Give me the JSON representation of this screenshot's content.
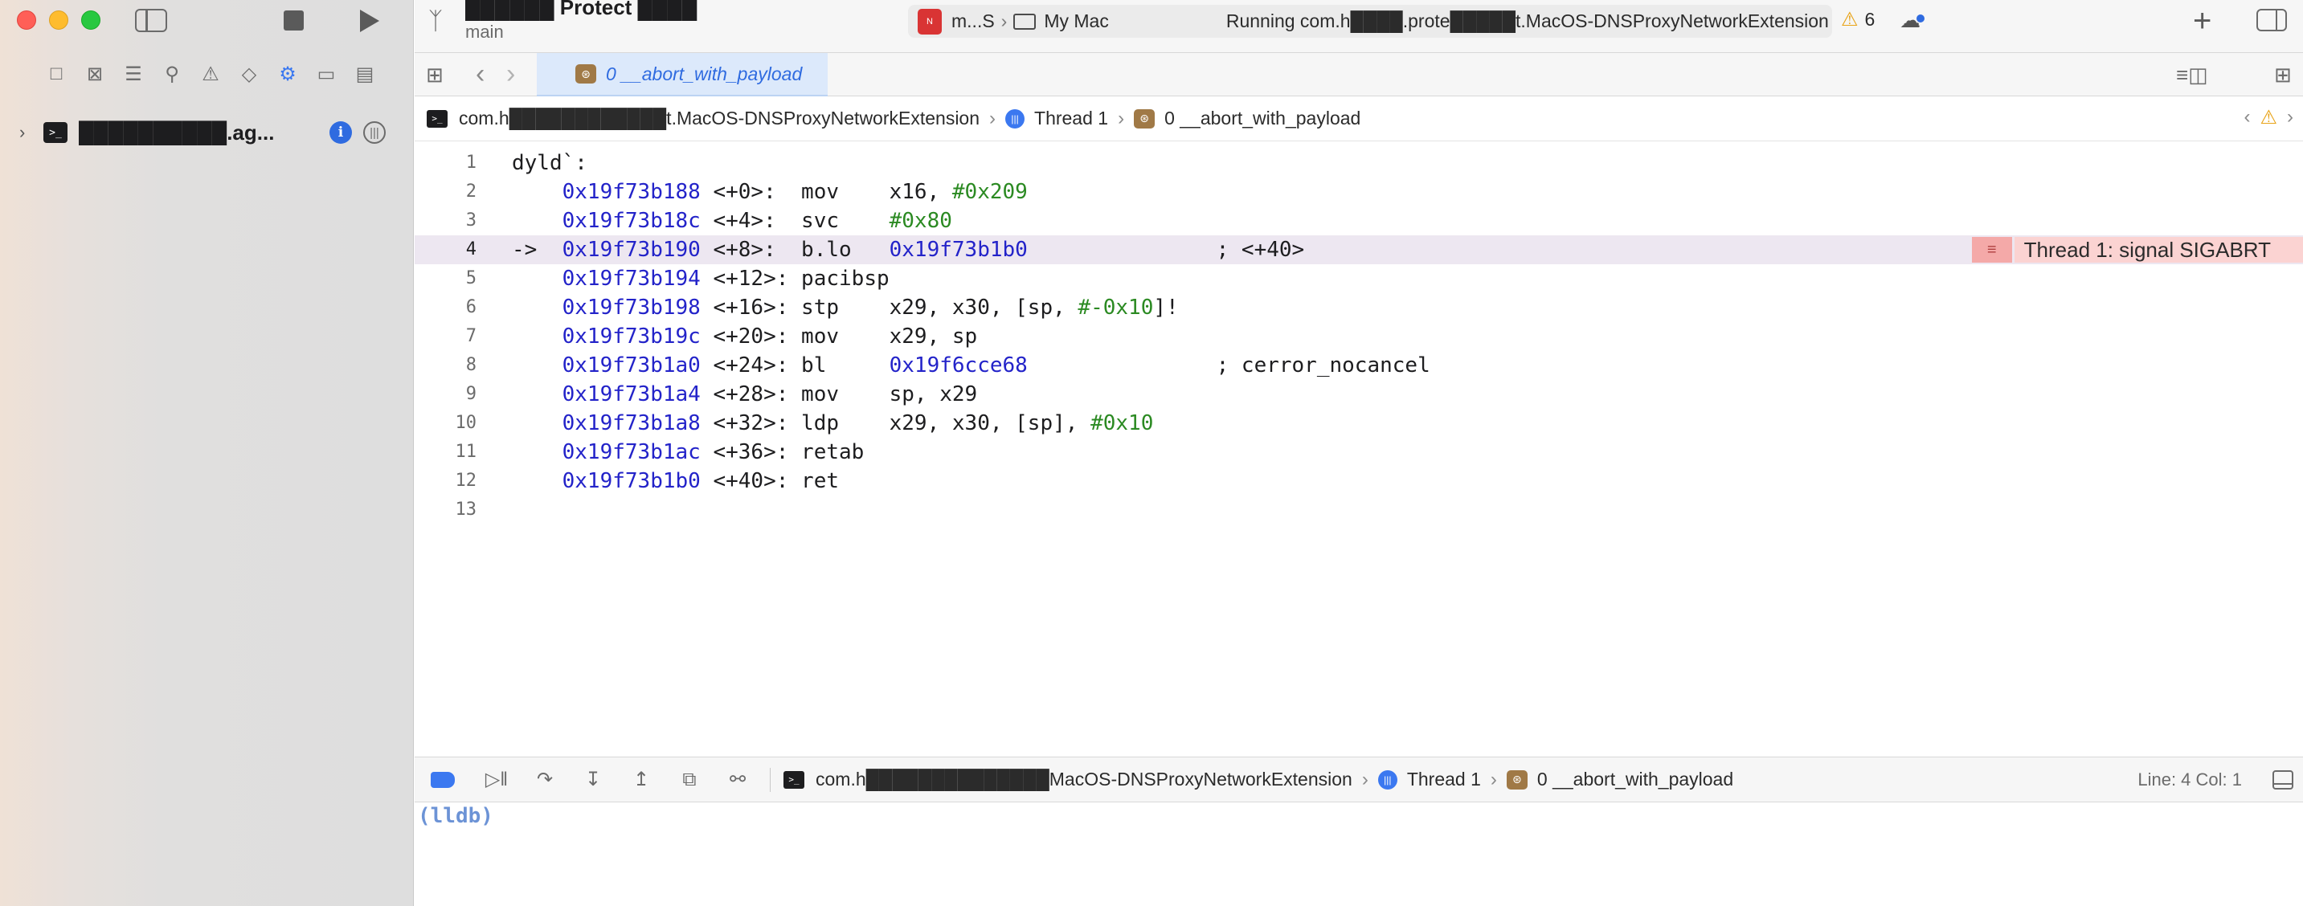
{
  "window": {
    "scheme_title": "██████ Protect ████",
    "branch": "main"
  },
  "activity": {
    "app_icon_text": "N",
    "scheme": "m...S",
    "destination": "My Mac",
    "status": "Running com.h████.prote█████t.MacOS-DNSProxyNetworkExtension",
    "warning_count": "6"
  },
  "sidebar": {
    "icons": [
      "folder-icon",
      "source-control-icon",
      "symbol-icon",
      "search-icon",
      "warning-icon",
      "test-icon",
      "debug-icon",
      "breakpoint-icon",
      "report-icon"
    ],
    "process_name": "██████████.ag...",
    "process_icon": ">_"
  },
  "tab": {
    "label": "0 __abort_with_payload"
  },
  "jumpbar": {
    "process": "com.h████████████t.MacOS-DNSProxyNetworkExtension",
    "thread": "Thread 1",
    "frame": "0 __abort_with_payload"
  },
  "code": {
    "lines": [
      {
        "n": "1",
        "label": "dyld`:",
        "addr": "",
        "off": "",
        "op": "",
        "args": "",
        "imm": "",
        "tail": "",
        "comment": ""
      },
      {
        "n": "2",
        "label": "",
        "addr": "0x19f73b188",
        "off": " <+0>:  ",
        "op": "mov   ",
        "args": " x16, ",
        "imm": "#0x209",
        "tail": "",
        "comment": ""
      },
      {
        "n": "3",
        "label": "",
        "addr": "0x19f73b18c",
        "off": " <+4>:  ",
        "op": "svc   ",
        "args": " ",
        "imm": "#0x80",
        "tail": "",
        "comment": ""
      },
      {
        "n": "4",
        "label": "",
        "addr": "0x19f73b190",
        "off": " <+8>:  ",
        "op": "b.lo  ",
        "args": " ",
        "imm": "",
        "tail": "0x19f73b1b0",
        "comment": "               ; <+40>",
        "current": true,
        "arrow": "->  "
      },
      {
        "n": "5",
        "label": "",
        "addr": "0x19f73b194",
        "off": " <+12>: ",
        "op": "pacibsp",
        "args": "",
        "imm": "",
        "tail": "",
        "comment": ""
      },
      {
        "n": "6",
        "label": "",
        "addr": "0x19f73b198",
        "off": " <+16>: ",
        "op": "stp   ",
        "args": " x29, x30, [sp, ",
        "imm": "#-0x10",
        "tail": "",
        "comment": "]!"
      },
      {
        "n": "7",
        "label": "",
        "addr": "0x19f73b19c",
        "off": " <+20>: ",
        "op": "mov   ",
        "args": " x29, sp",
        "imm": "",
        "tail": "",
        "comment": ""
      },
      {
        "n": "8",
        "label": "",
        "addr": "0x19f73b1a0",
        "off": " <+24>: ",
        "op": "bl    ",
        "args": " ",
        "imm": "",
        "tail": "0x19f6cce68",
        "comment": "               ; cerror_nocancel"
      },
      {
        "n": "9",
        "label": "",
        "addr": "0x19f73b1a4",
        "off": " <+28>: ",
        "op": "mov   ",
        "args": " sp, x29",
        "imm": "",
        "tail": "",
        "comment": ""
      },
      {
        "n": "10",
        "label": "",
        "addr": "0x19f73b1a8",
        "off": " <+32>: ",
        "op": "ldp   ",
        "args": " x29, x30, [sp], ",
        "imm": "#0x10",
        "tail": "",
        "comment": ""
      },
      {
        "n": "11",
        "label": "",
        "addr": "0x19f73b1ac",
        "off": " <+36>: ",
        "op": "retab",
        "args": "",
        "imm": "",
        "tail": "",
        "comment": ""
      },
      {
        "n": "12",
        "label": "",
        "addr": "0x19f73b1b0",
        "off": " <+40>: ",
        "op": "ret",
        "args": "",
        "imm": "",
        "tail": "",
        "comment": ""
      },
      {
        "n": "13",
        "label": "",
        "addr": "",
        "off": "",
        "op": "",
        "args": "",
        "imm": "",
        "tail": "",
        "comment": ""
      }
    ],
    "issue_text": "Thread 1: signal SIGABRT"
  },
  "debugbar": {
    "process": "com.h██████████████MacOS-DNSProxyNetworkExtension",
    "thread": "Thread 1",
    "frame": "0 __abort_with_payload",
    "line_col": "Line: 4  Col: 1"
  },
  "console": {
    "prompt": "(lldb)"
  },
  "colors": {
    "accent": "#3b78f0",
    "address": "#2323c9",
    "immediate": "#2b8a22",
    "current_line": "#ede7f1",
    "issue_bg": "#fbd3d2",
    "warning": "#e8a317"
  }
}
